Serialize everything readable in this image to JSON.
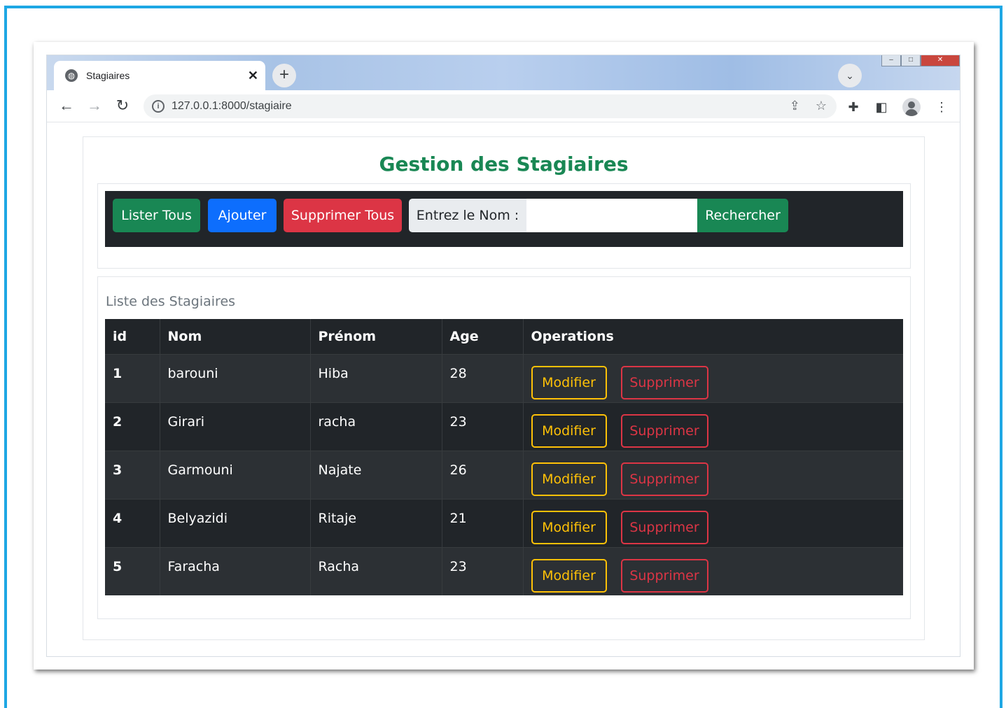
{
  "browser": {
    "tab_title": "Stagiaires",
    "url": "127.0.0.1:8000/stagiaire",
    "icons": [
      "globe-icon",
      "close-icon",
      "plus-icon",
      "chevron-down-icon",
      "back-arrow-icon",
      "forward-arrow-icon",
      "reload-icon",
      "info-icon",
      "share-icon",
      "star-icon",
      "extensions-icon",
      "side-panel-icon",
      "profile-icon",
      "menu-dots-icon"
    ]
  },
  "page": {
    "title": "Gestion des Stagiaires",
    "title_color": "#198754"
  },
  "actions": {
    "list_all": "Lister Tous",
    "add": "Ajouter",
    "delete_all": "Supprimer Tous",
    "search_label": "Entrez le Nom :",
    "search_value": "",
    "search_button": "Rechercher"
  },
  "list": {
    "caption": "Liste des Stagiaires",
    "columns": [
      "id",
      "Nom",
      "Prénom",
      "Age",
      "Operations"
    ],
    "rows": [
      {
        "id": "1",
        "nom": "barouni",
        "prenom": "Hiba",
        "age": "28"
      },
      {
        "id": "2",
        "nom": "Girari",
        "prenom": "racha",
        "age": "23"
      },
      {
        "id": "3",
        "nom": "Garmouni",
        "prenom": "Najate",
        "age": "26"
      },
      {
        "id": "4",
        "nom": "Belyazidi",
        "prenom": "Ritaje",
        "age": "21"
      },
      {
        "id": "5",
        "nom": "Faracha",
        "prenom": "Racha",
        "age": "23"
      }
    ],
    "modify_label": "Modifier",
    "delete_label": "Supprimer"
  },
  "colors": {
    "success": "#198754",
    "primary": "#0d6efd",
    "danger": "#dc3545",
    "warning": "#ffc107",
    "dark": "#212529",
    "frame": "#1ea7e4"
  }
}
